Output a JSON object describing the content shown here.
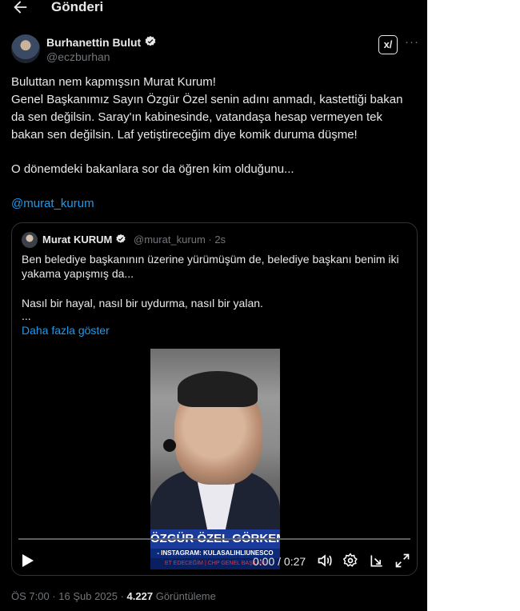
{
  "header": {
    "title": "Gönderi"
  },
  "author": {
    "name": "Burhanettin Bulut",
    "handle": "@eczburhan"
  },
  "grok_label": "x/",
  "tweet": {
    "lines": [
      "Buluttan nem kapmışsın Murat Kurum!",
      "Genel Başkanımız Sayın Özgür Özel senin adını anmadı, kastettiği bakan",
      "da sen değilsin. Saray'ın kabinesinde, vatandaşa hesap vermeyen tek",
      "bakan sen değilsin. Laf yetiştireceğim diye komik duruma düşme!",
      "O dönemdeki bakanlara sor da öğren kim olduğunu..."
    ],
    "mention": "@murat_kurum"
  },
  "quote": {
    "name": "Murat KURUM",
    "handle": "@murat_kurum · 2s",
    "lines": [
      "Ben belediye başkanının üzerine yürümüşüm de, belediye başkanı benim iki",
      "yakama yapışmış da...",
      "Nasıl bir hayal, nasıl bir uydurma, nasıl bir yalan.",
      "..."
    ],
    "show_more": "Daha fazla göster",
    "video": {
      "banner": "ÖZGÜR ÖZEL GÖRKEMLİ İ",
      "banner_sub": "- INSTAGRAM: KULASALIHLIUNESCO",
      "banner_small": "ET EDECEĞİM  |  CHP GENEL BAŞKANI",
      "time": "0:00 / 0:27",
      "progress": 0
    }
  },
  "meta": {
    "time": "ÖS 7:00 · 16 Şub 2025 · ",
    "views": "4.227",
    "views_label": " Görüntüleme"
  }
}
